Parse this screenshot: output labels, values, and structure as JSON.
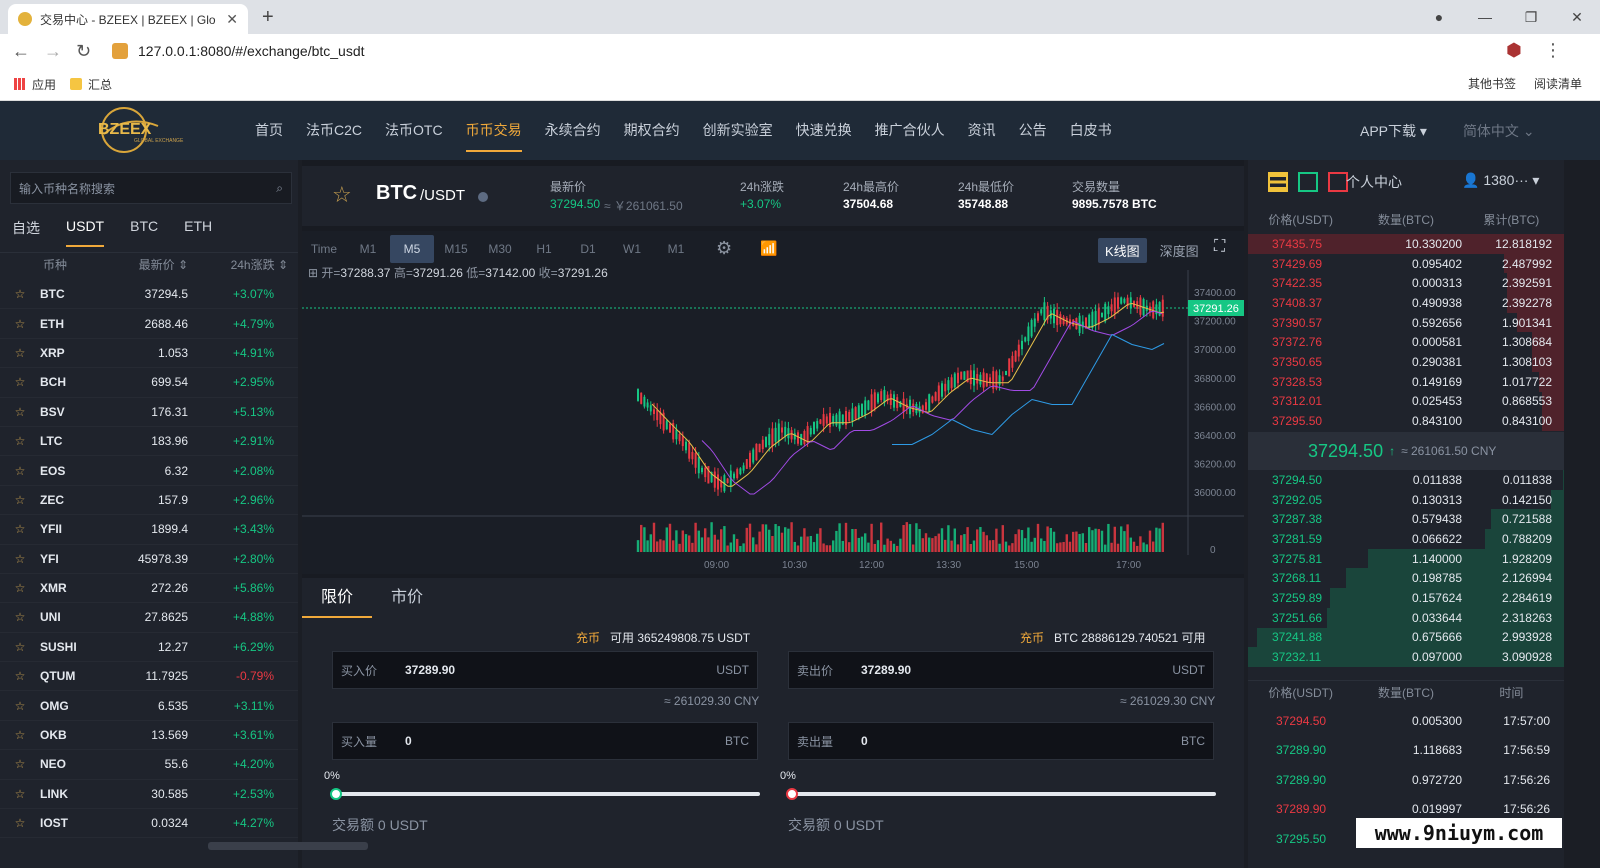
{
  "browser": {
    "tab_title": "交易中心 - BZEEX | BZEEX | Glo",
    "url": "127.0.0.1:8080/#/exchange/btc_usdt",
    "bookmarks": [
      "应用",
      "汇总"
    ],
    "bookmarks_right": [
      "其他书签",
      "阅读清单"
    ]
  },
  "header": {
    "logo_text": "BZEEX",
    "logo_sub": "GLOBAL EXCHANGE",
    "nav": [
      "首页",
      "法币C2C",
      "法币OTC",
      "币币交易",
      "永续合约",
      "期权合约",
      "创新实验室",
      "快速兑换",
      "推广合伙人",
      "资讯",
      "公告",
      "白皮书"
    ],
    "active_nav": "币币交易",
    "app_download": "APP下载",
    "language": "简体中文"
  },
  "market_list": {
    "search_placeholder": "输入币种名称搜索",
    "tabs": [
      "自选",
      "USDT",
      "BTC",
      "ETH"
    ],
    "active_tab": "USDT",
    "columns": [
      "币种",
      "最新价",
      "24h涨跌"
    ],
    "rows": [
      {
        "coin": "BTC",
        "price": "37294.5",
        "change": "+3.07%"
      },
      {
        "coin": "ETH",
        "price": "2688.46",
        "change": "+4.79%"
      },
      {
        "coin": "XRP",
        "price": "1.053",
        "change": "+4.91%"
      },
      {
        "coin": "BCH",
        "price": "699.54",
        "change": "+2.95%"
      },
      {
        "coin": "BSV",
        "price": "176.31",
        "change": "+5.13%"
      },
      {
        "coin": "LTC",
        "price": "183.96",
        "change": "+2.91%"
      },
      {
        "coin": "EOS",
        "price": "6.32",
        "change": "+2.08%"
      },
      {
        "coin": "ZEC",
        "price": "157.9",
        "change": "+2.96%"
      },
      {
        "coin": "YFII",
        "price": "1899.4",
        "change": "+3.43%"
      },
      {
        "coin": "YFI",
        "price": "45978.39",
        "change": "+2.80%"
      },
      {
        "coin": "XMR",
        "price": "272.26",
        "change": "+5.86%"
      },
      {
        "coin": "UNI",
        "price": "27.8625",
        "change": "+4.88%"
      },
      {
        "coin": "SUSHI",
        "price": "12.27",
        "change": "+6.29%"
      },
      {
        "coin": "QTUM",
        "price": "11.7925",
        "change": "-0.79%"
      },
      {
        "coin": "OMG",
        "price": "6.535",
        "change": "+3.11%"
      },
      {
        "coin": "OKB",
        "price": "13.569",
        "change": "+3.61%"
      },
      {
        "coin": "NEO",
        "price": "55.6",
        "change": "+4.20%"
      },
      {
        "coin": "LINK",
        "price": "30.585",
        "change": "+2.53%"
      },
      {
        "coin": "IOST",
        "price": "0.0324",
        "change": "+4.27%"
      }
    ]
  },
  "ticker": {
    "pair_base": "BTC",
    "pair_quote": "/USDT",
    "last_label": "最新价",
    "last_price": "37294.50",
    "last_cny": "≈ ￥261061.50",
    "change_label": "24h涨跌",
    "change": "+3.07%",
    "high_label": "24h最高价",
    "high": "37504.68",
    "low_label": "24h最低价",
    "low": "35748.88",
    "volume_label": "交易数量",
    "volume": "9895.7578 BTC"
  },
  "chart": {
    "timeframes": [
      "Time",
      "M1",
      "M5",
      "M15",
      "M30",
      "H1",
      "D1",
      "W1",
      "M1"
    ],
    "active_timeframe": "M5",
    "kline_btn": "K线图",
    "depth_btn": "深度图",
    "ohlc": {
      "open_label": "开=",
      "open": "37288.37",
      "high_label": "高=",
      "high": "37291.26",
      "low_label": "低=",
      "low": "37142.00",
      "close_label": "收=",
      "close": "37291.26"
    },
    "price_tag": "37291.26",
    "y_ticks": [
      "37400.00",
      "37200.00",
      "37000.00",
      "36800.00",
      "36600.00",
      "36400.00",
      "36200.00",
      "36000.00"
    ],
    "x_ticks": [
      "09:00",
      "10:30",
      "12:00",
      "13:30",
      "15:00",
      "17:00"
    ],
    "volume_zero": "0"
  },
  "order": {
    "tabs": [
      "限价",
      "市价"
    ],
    "active_tab": "限价",
    "buy": {
      "recharge": "充币",
      "available": "可用 365249808.75 USDT",
      "price_label": "买入价",
      "price": "37289.90",
      "price_unit": "USDT",
      "cny": "≈ 261029.30 CNY",
      "amount_label": "买入量",
      "amount": "0",
      "amount_unit": "BTC",
      "percent": "0%",
      "total": "交易额 0 USDT"
    },
    "sell": {
      "recharge": "充币",
      "available": "BTC 28886129.740521 可用",
      "price_label": "卖出价",
      "price": "37289.90",
      "price_unit": "USDT",
      "cny": "≈ 261029.30 CNY",
      "amount_label": "卖出量",
      "amount": "0",
      "amount_unit": "BTC",
      "percent": "0%",
      "total": "交易额 0 USDT"
    }
  },
  "orderbook": {
    "user_center": "个人中心",
    "user": "1380···",
    "columns": [
      "价格(USDT)",
      "数量(BTC)",
      "累计(BTC)"
    ],
    "asks": [
      {
        "p": "37435.75",
        "q": "10.330200",
        "t": "12.818192",
        "depth": 1.0
      },
      {
        "p": "37429.69",
        "q": "0.095402",
        "t": "2.487992",
        "depth": 0.19
      },
      {
        "p": "37422.35",
        "q": "0.000313",
        "t": "2.392591",
        "depth": 0.18
      },
      {
        "p": "37408.37",
        "q": "0.490938",
        "t": "2.392278",
        "depth": 0.18
      },
      {
        "p": "37390.57",
        "q": "0.592656",
        "t": "1.901341",
        "depth": 0.15
      },
      {
        "p": "37372.76",
        "q": "0.000581",
        "t": "1.308684",
        "depth": 0.1
      },
      {
        "p": "37350.65",
        "q": "0.290381",
        "t": "1.308103",
        "depth": 0.1
      },
      {
        "p": "37328.53",
        "q": "0.149169",
        "t": "1.017722",
        "depth": 0.08
      },
      {
        "p": "37312.01",
        "q": "0.025453",
        "t": "0.868553",
        "depth": 0.07
      },
      {
        "p": "37295.50",
        "q": "0.843100",
        "t": "0.843100",
        "depth": 0.07
      }
    ],
    "mid_price": "37294.50",
    "mid_arrow": "↑",
    "mid_cny": "≈ 261061.50 CNY",
    "bids": [
      {
        "p": "37294.50",
        "q": "0.011838",
        "t": "0.011838",
        "depth": 0.003
      },
      {
        "p": "37292.05",
        "q": "0.130313",
        "t": "0.142150",
        "depth": 0.04
      },
      {
        "p": "37287.38",
        "q": "0.579438",
        "t": "0.721588",
        "depth": 0.23
      },
      {
        "p": "37281.59",
        "q": "0.066622",
        "t": "0.788209",
        "depth": 0.25
      },
      {
        "p": "37275.81",
        "q": "1.140000",
        "t": "1.928209",
        "depth": 0.62
      },
      {
        "p": "37268.11",
        "q": "0.198785",
        "t": "2.126994",
        "depth": 0.69
      },
      {
        "p": "37259.89",
        "q": "0.157624",
        "t": "2.284619",
        "depth": 0.74
      },
      {
        "p": "37251.66",
        "q": "0.033644",
        "t": "2.318263",
        "depth": 0.75
      },
      {
        "p": "37241.88",
        "q": "0.675666",
        "t": "2.993928",
        "depth": 0.97
      },
      {
        "p": "37232.11",
        "q": "0.097000",
        "t": "3.090928",
        "depth": 1.0
      }
    ]
  },
  "trades": {
    "columns": [
      "价格(USDT)",
      "数量(BTC)",
      "时间"
    ],
    "rows": [
      {
        "p": "37294.50",
        "q": "0.005300",
        "t": "17:57:00",
        "side": "sell"
      },
      {
        "p": "37289.90",
        "q": "1.118683",
        "t": "17:56:59",
        "side": "buy"
      },
      {
        "p": "37289.90",
        "q": "0.972720",
        "t": "17:56:26",
        "side": "buy"
      },
      {
        "p": "37289.90",
        "q": "0.019997",
        "t": "17:56:26",
        "side": "sell"
      },
      {
        "p": "37295.50",
        "q": "",
        "t": "",
        "side": "buy"
      }
    ]
  },
  "watermark": "www.9niuym.com"
}
